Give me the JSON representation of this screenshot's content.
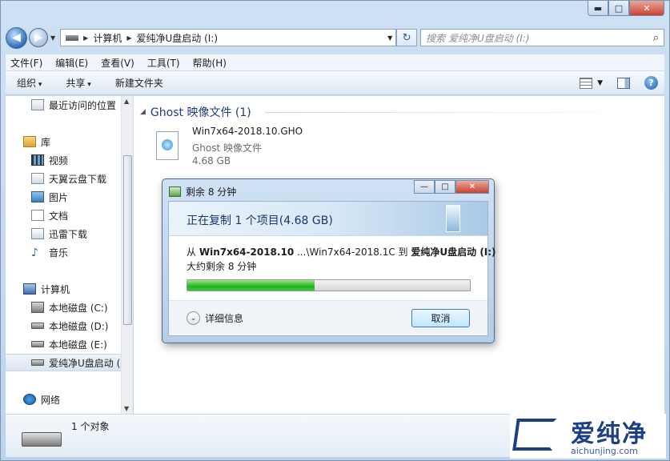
{
  "window": {
    "caption": {
      "minimize": "▬",
      "maximize": "□",
      "close": "✕"
    }
  },
  "address": {
    "crumbs": [
      "计算机",
      "爱纯净U盘启动 (I:)"
    ],
    "search_placeholder": "搜索 爱纯净U盘启动 (I:)"
  },
  "menu": [
    "文件(F)",
    "编辑(E)",
    "查看(V)",
    "工具(T)",
    "帮助(H)"
  ],
  "commands": {
    "organize": "组织",
    "share": "共享",
    "new_folder": "新建文件夹"
  },
  "sidebar": {
    "items": [
      {
        "label": "最近访问的位置",
        "icon": "recent-places-icon"
      },
      {
        "label": "库",
        "icon": "library-icon"
      },
      {
        "label": "视频",
        "icon": "video-icon"
      },
      {
        "label": "天翼云盘下载",
        "icon": "cloud-folder-icon"
      },
      {
        "label": "图片",
        "icon": "pictures-icon"
      },
      {
        "label": "文档",
        "icon": "documents-icon"
      },
      {
        "label": "迅雷下载",
        "icon": "download-folder-icon"
      },
      {
        "label": "音乐",
        "icon": "music-icon"
      },
      {
        "label": "计算机",
        "icon": "computer-icon"
      },
      {
        "label": "本地磁盘 (C:)",
        "icon": "system-drive-icon"
      },
      {
        "label": "本地磁盘 (D:)",
        "icon": "drive-icon"
      },
      {
        "label": "本地磁盘 (E:)",
        "icon": "drive-icon"
      },
      {
        "label": "爱纯净U盘启动 (",
        "icon": "usb-drive-icon"
      },
      {
        "label": "网络",
        "icon": "network-icon"
      }
    ]
  },
  "content": {
    "group_header": "Ghost 映像文件 (1)",
    "file": {
      "name": "Win7x64-2018.10.GHO",
      "type": "Ghost 映像文件",
      "size": "4.68 GB"
    }
  },
  "details_pane": {
    "count": "1 个对象"
  },
  "copy_dialog": {
    "title": "剩余 8 分钟",
    "heading": "正在复制 1 个项目(4.68 GB)",
    "from_label": "从",
    "from_name": "Win7x64-2018.10",
    "from_path": " ...\\Win7x64-2018.1C",
    "to_label": "到",
    "to_name": "爱纯净U盘启动 (I:)",
    "remaining": "大约剩余 8 分钟",
    "progress": 0.45,
    "more_details": "详细信息",
    "cancel": "取消",
    "caption": {
      "minimize": "—",
      "maximize": "□",
      "close": "✕"
    }
  },
  "watermark": {
    "brand": "爱纯净",
    "url": "aichunjing.com"
  },
  "colors": {
    "progress": "#22b41f",
    "accent": "#1d3f86",
    "header_text": "#1e3c7a"
  }
}
